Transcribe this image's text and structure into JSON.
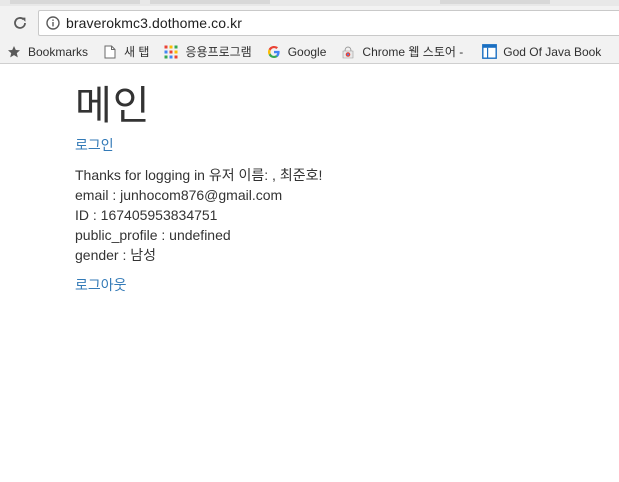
{
  "browser": {
    "url": "braverokmc3.dothome.co.kr",
    "bookmarks": [
      {
        "label": "Bookmarks",
        "icon": "star-icon"
      },
      {
        "label": "새 탭",
        "icon": "page-icon"
      },
      {
        "label": "응용프로그램",
        "icon": "apps-grid-icon"
      },
      {
        "label": "Google",
        "icon": "google-g-icon"
      },
      {
        "label": "Chrome 웹 스토어 -",
        "icon": "chrome-webstore-icon"
      },
      {
        "label": "God Of Java Book",
        "icon": "window-icon"
      }
    ]
  },
  "page": {
    "title": "메인",
    "login_link": "로그인",
    "info": {
      "thanks": "Thanks for logging in 유저 이름: , 최준호!",
      "email": "email : junhocom876@gmail.com",
      "id": "ID : 167405953834751",
      "public_profile": "public_profile : undefined",
      "gender": "gender : 남성"
    },
    "logout_link": "로그아웃"
  },
  "colors": {
    "link": "#337ab7",
    "text": "#333333",
    "chrome_bg": "#f2f2f2"
  }
}
